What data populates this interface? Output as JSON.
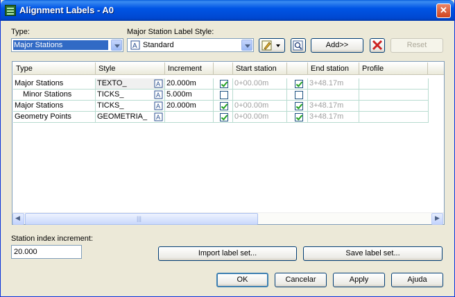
{
  "window": {
    "title": "Alignment Labels - A0",
    "close_glyph": "✕"
  },
  "type_field": {
    "label": "Type:",
    "value": "Major Stations"
  },
  "style_field": {
    "label": "Major Station Label Style:",
    "value": "Standard"
  },
  "buttons": {
    "add": "Add>>",
    "reset": "Reset",
    "import": "Import label set...",
    "save": "Save label set...",
    "ok": "OK",
    "cancel": "Cancelar",
    "apply": "Apply",
    "help": "Ajuda"
  },
  "icons": {
    "edit": "pencil-edit-icon",
    "preview": "magnifier-preview-icon",
    "delete": "red-x-delete-icon",
    "style": "label-style-icon"
  },
  "table": {
    "headers": [
      "Type",
      "Style",
      "Increment",
      "",
      "Start station",
      "",
      "End station",
      "Profile"
    ],
    "rows": [
      {
        "type": "Major Stations",
        "style": "TEXTO_",
        "increment": "20.000m",
        "start_on": true,
        "start": "0+00.00m",
        "end_on": true,
        "end": "3+48.17m",
        "profile": ""
      },
      {
        "type": "Minor Stations",
        "style": "TICKS_",
        "increment": "5.000m",
        "start_on": false,
        "start": "",
        "end_on": false,
        "end": "",
        "profile": ""
      },
      {
        "type": "Major Stations",
        "style": "TICKS_",
        "increment": "20.000m",
        "start_on": true,
        "start": "0+00.00m",
        "end_on": true,
        "end": "3+48.17m",
        "profile": ""
      },
      {
        "type": "Geometry Points",
        "style": "GEOMETRIA_",
        "increment": "",
        "start_on": true,
        "start": "0+00.00m",
        "end_on": true,
        "end": "3+48.17m",
        "profile": ""
      }
    ]
  },
  "scrollbar": {
    "grip": "|||",
    "left": "◀",
    "right": "▶"
  },
  "station_index": {
    "label": "Station index increment:",
    "value": "20.000"
  },
  "colors": {
    "title_bar": "#0055e5",
    "accent_red": "#cc2222",
    "check_green": "#21a121"
  }
}
